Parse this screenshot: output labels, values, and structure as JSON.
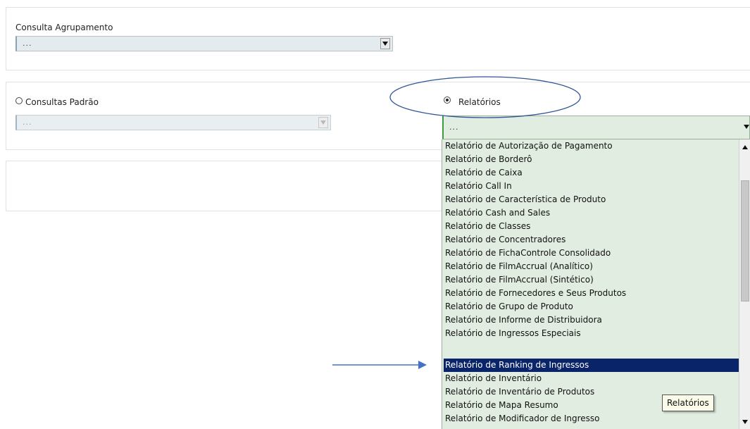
{
  "grouping": {
    "label": "Consulta Agrupamento",
    "value": "..."
  },
  "standard_queries": {
    "label": "Consultas Padrão",
    "value": "...",
    "selected": false
  },
  "reports": {
    "label": "Relatórios",
    "value": "...",
    "selected": true,
    "options": [
      "Relatório de Autorização de Pagamento",
      "Relatório de Borderô",
      "Relatório de Caixa",
      "Relatório Call In",
      "Relatório de Característica de Produto",
      "Relatório Cash and Sales",
      "Relatório de Classes",
      "Relatório de Concentradores",
      "Relatório de FichaControle Consolidado",
      "Relatório de FilmAccrual (Analítico)",
      "Relatório de FilmAccrual (Sintético)",
      "Relatório de Fornecedores e Seus Produtos",
      "Relatório de Grupo de Produto",
      "Relatório de Informe de Distribuidora",
      "Relatório de Ingressos Especiais",
      "Relatório de Ranking de Ingressos",
      "Relatório de Inventário",
      "Relatório de Inventário de Produtos",
      "Relatório de Mapa Resumo",
      "Relatório de Modificador de Ingresso"
    ],
    "highlighted_option": "Relatório de Ranking de Ingressos"
  },
  "tooltip": "Relatórios",
  "annotations": {
    "ellipse_color": "#2f5597",
    "arrow_color": "#4472c4"
  }
}
